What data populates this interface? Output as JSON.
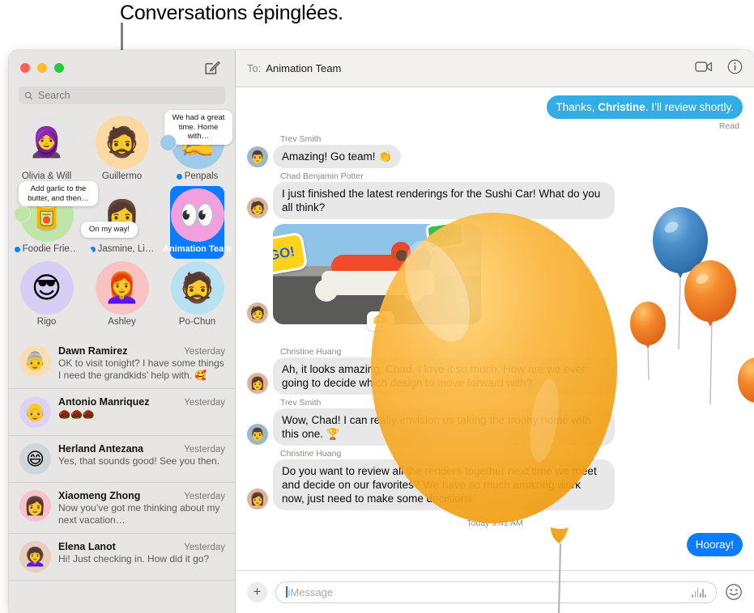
{
  "callout": {
    "text": "Conversations épinglées."
  },
  "window": {
    "traffic_lights": [
      "close",
      "minimize",
      "zoom"
    ]
  },
  "sidebar": {
    "compose_icon": "compose-icon",
    "search": {
      "icon": "search-icon",
      "placeholder": "Search",
      "value": ""
    },
    "pinned": [
      {
        "label": "Olivia & Will",
        "unread": false,
        "selected": false,
        "tooltip": null,
        "bg": "#e6e4e4",
        "glyph": "🧕"
      },
      {
        "label": "Guillermo",
        "unread": false,
        "selected": false,
        "tooltip": null,
        "bg": "#fcd9a0",
        "glyph": "🧔"
      },
      {
        "label": "Penpals",
        "unread": true,
        "selected": false,
        "tooltip": "We had a great time. Home with…",
        "bg": "#9ecbe8",
        "glyph": "✍️"
      },
      {
        "label": "Foodie Frie…",
        "unread": true,
        "selected": false,
        "tooltip": "Add garlic to the butter, and then…",
        "bg": "#bfe6a8",
        "glyph": "🥫"
      },
      {
        "label": "Jasmine, Li…",
        "unread": true,
        "selected": false,
        "tooltip": "On my way!",
        "bg": "#e6e4e4",
        "glyph": "👩"
      },
      {
        "label": "Animation Team",
        "unread": false,
        "selected": true,
        "tooltip": null,
        "bg": "#f2a0dd",
        "glyph": "👀"
      },
      {
        "label": "Rigo",
        "unread": false,
        "selected": false,
        "tooltip": null,
        "bg": "#d8cdf5",
        "glyph": "😎"
      },
      {
        "label": "Ashley",
        "unread": false,
        "selected": false,
        "tooltip": null,
        "bg": "#f9c2c2",
        "glyph": "👩‍🦰"
      },
      {
        "label": "Po-Chun",
        "unread": false,
        "selected": false,
        "tooltip": null,
        "bg": "#b8e2f2",
        "glyph": "🧔"
      }
    ],
    "conversations": [
      {
        "name": "Dawn Ramirez",
        "time": "Yesterday",
        "preview": "OK to visit tonight? I have some things I need the grandkids’ help with. 🥰",
        "bg": "#fbddb4",
        "glyph": "👵"
      },
      {
        "name": "Antonio Manriquez",
        "time": "Yesterday",
        "preview": "🌰🌰🌰",
        "bg": "#ded3f7",
        "glyph": "👴"
      },
      {
        "name": "Herland Antezana",
        "time": "Yesterday",
        "preview": "Yes, that sounds good! See you then.",
        "bg": "#cfd6d9",
        "glyph": "😄"
      },
      {
        "name": "Xiaomeng Zhong",
        "time": "Yesterday",
        "preview": "Now you’ve got me thinking about my next vacation…",
        "bg": "#f7c2cb",
        "glyph": "👩"
      },
      {
        "name": "Elena Lanot",
        "time": "Yesterday",
        "preview": "Hi! Just checking in. How did it go?",
        "bg": "#e9cdbf",
        "glyph": "👩‍🦱"
      }
    ]
  },
  "thread": {
    "to_label": "To:",
    "to_value": "Animation Team",
    "video_icon": "facetime-video-icon",
    "info_icon": "info-circle-icon",
    "outgoing_top": {
      "text_plain_1": "Thanks, ",
      "text_bold": "Christine",
      "text_plain_2": ". I’ll review shortly.",
      "status": "Read"
    },
    "messages": [
      {
        "sender": "Trev Smith",
        "text": "Amazing! Go team! 👏",
        "av_bg": "#9cb8c8",
        "glyph": "👨"
      },
      {
        "sender": "Chad Benjamin Potter",
        "text": "I just finished the latest renderings for the Sushi Car! What do you all think?",
        "av_bg": "#d6b79a",
        "glyph": "🧑"
      },
      {
        "sender": "Christine Huang",
        "text": "Ah, it looks amazing, Chad. I love it so much. How are we ever going to decide which design to move forward with?",
        "av_bg": "#e0b49a",
        "glyph": "👩"
      },
      {
        "sender": "Trev Smith",
        "text": "Wow, Chad! I can really envision us taking the trophy home with this one. 🏆",
        "av_bg": "#9cb8c8",
        "glyph": "👨"
      },
      {
        "sender": "Christine Huang",
        "text": "Do you want to review all the renders together next time we meet and decide on our favorites? We have so much amazing work now, just need to make some decisions.",
        "av_bg": "#e0b49a",
        "glyph": "👩"
      }
    ],
    "image_message": {
      "name": "sushi-car-render",
      "stickers": [
        "GO!",
        "ZM",
        "🫶"
      ]
    },
    "timestamp": "Today 9:41 AM",
    "outgoing_bottom": {
      "text": "Hooray!"
    },
    "composer": {
      "plus_icon": "plus-icon",
      "placeholder": "iMessage",
      "value": "",
      "audio_icon": "audio-waveform-icon",
      "emoji_icon": "emoji-smiley-icon"
    }
  },
  "colors": {
    "accent_blue": "#0b7bff",
    "bubble_blue": "#32ade6",
    "unread_dot": "#0b84ff",
    "sidebar_bg": "#e7e6e5",
    "bubble_gray": "#e8e8e8",
    "balloon_orange": "#f5a623",
    "balloon_blue": "#3a7ebf",
    "balloon_deep_orange": "#f07d2a"
  }
}
